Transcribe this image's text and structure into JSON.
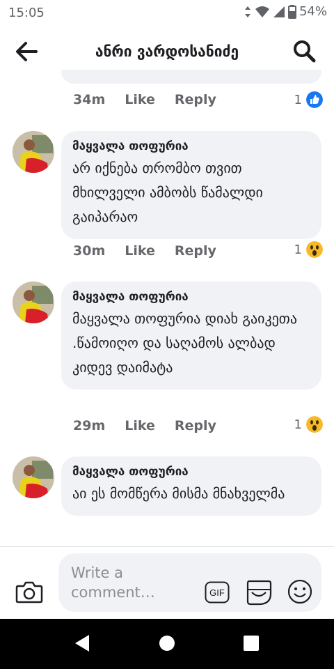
{
  "status_bar": {
    "time": "15:05",
    "battery": "54%"
  },
  "header": {
    "title": "ანრი ვარდოსანიძე"
  },
  "previous_comment": {
    "time": "34m",
    "like": "Like",
    "reply": "Reply",
    "reaction_count": "1",
    "reaction": "like-reaction-icon"
  },
  "comments": [
    {
      "author": "მაყვალა თოფურია",
      "text": "არ იქნება თრომბო თვით მხილველი ამბობს წამალდი გაიპარაო",
      "time": "30m",
      "like": "Like",
      "reply": "Reply",
      "reaction_count": "1"
    },
    {
      "author": "მაყვალა თოფურია",
      "text": "მაყვალა თოფურია დიახ გაიკეთა .წამოიღო და საღამოს ალბად კიდევ დაიმატა",
      "time": "29m",
      "like": "Like",
      "reply": "Reply",
      "reaction_count": "1"
    },
    {
      "author": "მაყვალა თოფურია",
      "text": "აი ეს მომწერა მისმა მნახველმა"
    }
  ],
  "composer": {
    "placeholder": "Write a comment…",
    "gif_label": "GIF"
  },
  "colors": {
    "bubble": "#f0f2f5",
    "like_blue": "#1877f2",
    "muted_text": "#65676b"
  }
}
